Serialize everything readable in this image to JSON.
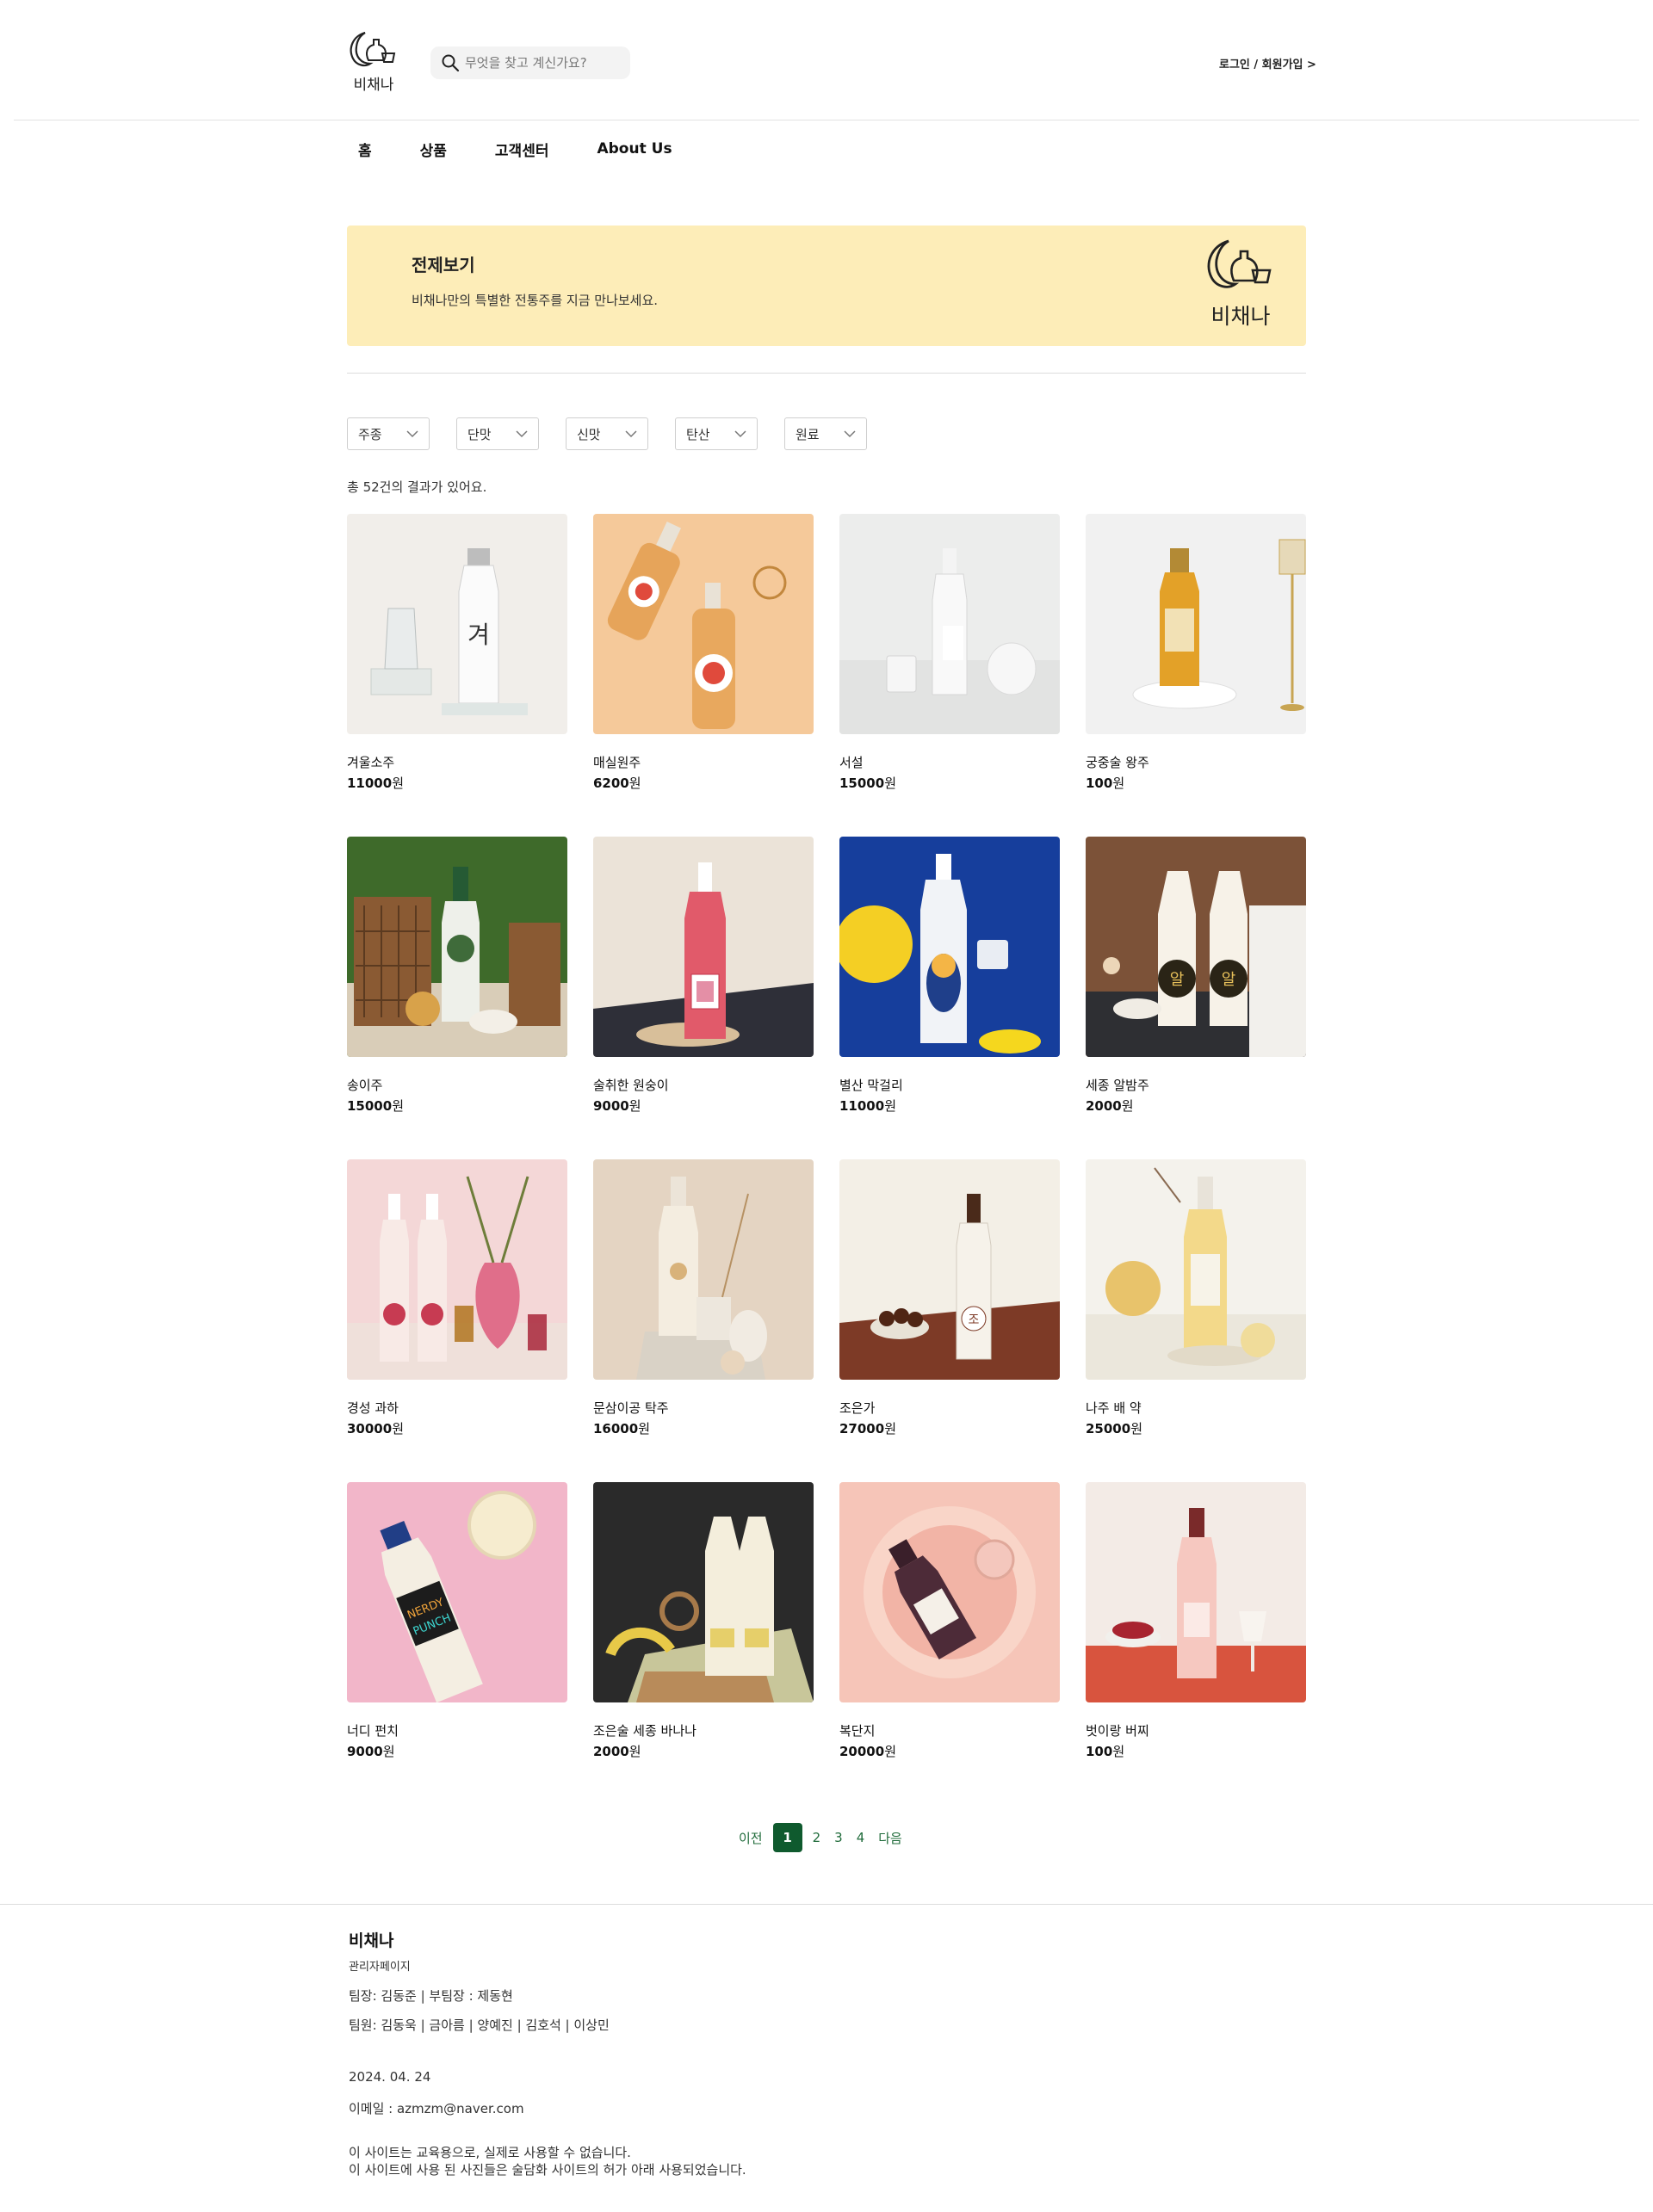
{
  "header": {
    "logo_text": "비채나",
    "search_placeholder": "무엇을 찾고 계신가요?",
    "login_label": "로그인 / 회원가입 >"
  },
  "nav": {
    "items": [
      "홈",
      "상품",
      "고객센터",
      "About Us"
    ]
  },
  "banner": {
    "title": "전제보기",
    "description": "비채나만의 특별한 전통주를 지금 만나보세요.",
    "logo_text": "비채나",
    "background": "#fdedb8"
  },
  "filters": [
    "주종",
    "단맛",
    "신맛",
    "탄산",
    "원료"
  ],
  "result_count": "총 52건의 결과가 있어요.",
  "products": [
    {
      "name": "겨울소주",
      "price": "11000",
      "unit": "원"
    },
    {
      "name": "매실원주",
      "price": "6200",
      "unit": "원"
    },
    {
      "name": "서설",
      "price": "15000",
      "unit": "원"
    },
    {
      "name": "궁중술 왕주",
      "price": "100",
      "unit": "원"
    },
    {
      "name": "송이주",
      "price": "15000",
      "unit": "원"
    },
    {
      "name": "술취한 원숭이",
      "price": "9000",
      "unit": "원"
    },
    {
      "name": "별산 막걸리",
      "price": "11000",
      "unit": "원"
    },
    {
      "name": "세종 알밤주",
      "price": "2000",
      "unit": "원"
    },
    {
      "name": "경성 과하",
      "price": "30000",
      "unit": "원"
    },
    {
      "name": "문삼이공 탁주",
      "price": "16000",
      "unit": "원"
    },
    {
      "name": "조은가",
      "price": "27000",
      "unit": "원"
    },
    {
      "name": "나주 배 약",
      "price": "25000",
      "unit": "원"
    },
    {
      "name": "너디 펀치",
      "price": "9000",
      "unit": "원"
    },
    {
      "name": "조은술 세종 바나나",
      "price": "2000",
      "unit": "원"
    },
    {
      "name": "복단지",
      "price": "20000",
      "unit": "원"
    },
    {
      "name": "벗이랑 버찌",
      "price": "100",
      "unit": "원"
    }
  ],
  "pagination": {
    "prev": "이전",
    "pages": [
      "1",
      "2",
      "3",
      "4"
    ],
    "current": "1",
    "next": "다음"
  },
  "footer": {
    "title": "비채나",
    "admin": "관리자페이지",
    "leaders": "팀장: 김동준 | 부팀장 : 제동현",
    "members": "팀원: 김동욱 | 금아름 | 양예진 | 김호석 | 이상민",
    "date": "2024. 04. 24",
    "email": "이메일 : azmzm@naver.com",
    "notice1": "이 사이트는 교육용으로, 실제로 사용할 수 없습니다.",
    "notice2": "이 사이트에 사용 된 사진들은 술담화 사이트의 허가 아래 사용되었습니다."
  },
  "colors": {
    "accent": "#0f5a2e",
    "banner": "#fdedb8"
  }
}
